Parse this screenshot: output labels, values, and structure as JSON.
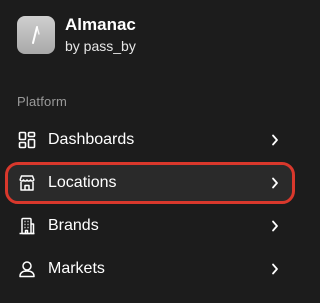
{
  "app": {
    "title": "Almanac",
    "subtitle": "by pass_by",
    "logo_icon": "slash-logo-icon"
  },
  "section": {
    "label": "Platform"
  },
  "nav": {
    "items": [
      {
        "label": "Dashboards",
        "icon": "dashboard-grid-icon",
        "selected": false
      },
      {
        "label": "Locations",
        "icon": "storefront-icon",
        "selected": true
      },
      {
        "label": "Brands",
        "icon": "building-icon",
        "selected": false
      },
      {
        "label": "Markets",
        "icon": "user-icon",
        "selected": false
      }
    ]
  },
  "colors": {
    "background": "#1c1c1c",
    "selected_outline": "#d9382c",
    "section_label": "#9a9a9a",
    "text": "#ffffff"
  }
}
